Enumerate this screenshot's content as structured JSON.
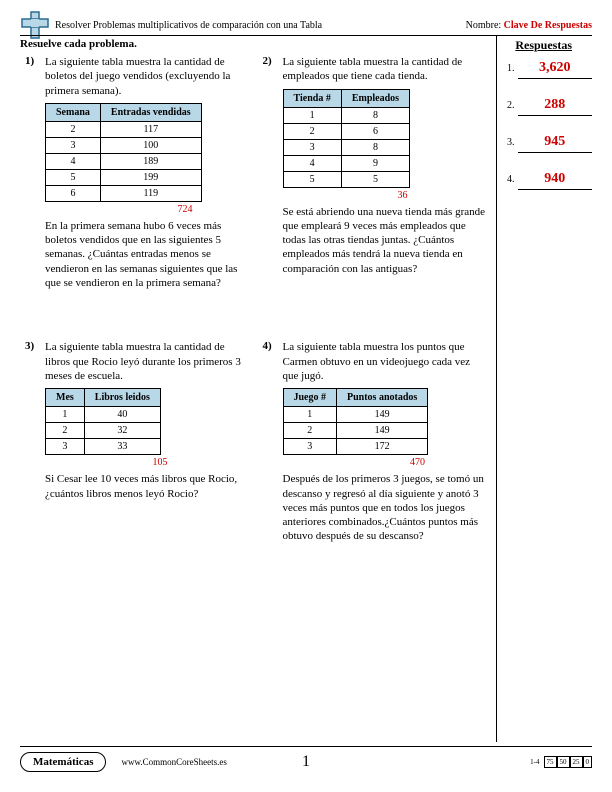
{
  "header": {
    "title": "Resolver Problemas multiplicativos de comparación con una Tabla",
    "name_label": "Nombre:",
    "answer_key": "Clave De Respuestas"
  },
  "instruction": "Resuelve cada problema.",
  "answers_header": "Respuestas",
  "answers": [
    {
      "num": "1.",
      "value": "3,620"
    },
    {
      "num": "2.",
      "value": "288"
    },
    {
      "num": "3.",
      "value": "945"
    },
    {
      "num": "4.",
      "value": "940"
    }
  ],
  "problems": [
    {
      "num": "1)",
      "intro": "La siguiente tabla muestra la cantidad de boletos del juego vendidos (excluyendo la primera semana).",
      "headers": [
        "Semana",
        "Entradas vendidas"
      ],
      "rows": [
        [
          "2",
          "117"
        ],
        [
          "3",
          "100"
        ],
        [
          "4",
          "189"
        ],
        [
          "5",
          "199"
        ],
        [
          "6",
          "119"
        ]
      ],
      "sum": "724",
      "sum_offset": "120px",
      "question": "En la primera semana hubo 6 veces más boletos vendidos que en las siguientes 5 semanas. ¿Cuántas entradas menos se vendieron en las semanas siguientes que las que se vendieron en la primera semana?"
    },
    {
      "num": "2)",
      "intro": "La siguiente tabla muestra la cantidad de empleados que tiene cada tienda.",
      "headers": [
        "Tienda #",
        "Empleados"
      ],
      "rows": [
        [
          "1",
          "8"
        ],
        [
          "2",
          "6"
        ],
        [
          "3",
          "8"
        ],
        [
          "4",
          "9"
        ],
        [
          "5",
          "5"
        ]
      ],
      "sum": "36",
      "sum_offset": "100px",
      "question": "Se está abriendo una nueva tienda más grande que empleará 9 veces más empleados que todas las otras tiendas juntas. ¿Cuántos empleados más tendrá la nueva tienda en comparación con las antiguas?"
    },
    {
      "num": "3)",
      "intro": "La siguiente tabla muestra la cantidad de libros que Rocio leyó durante los primeros 3 meses de escuela.",
      "headers": [
        "Mes",
        "Libros leidos"
      ],
      "rows": [
        [
          "1",
          "40"
        ],
        [
          "2",
          "32"
        ],
        [
          "3",
          "33"
        ]
      ],
      "sum": "105",
      "sum_offset": "95px",
      "question": "Si Cesar lee 10 veces más libros que Rocio, ¿cuántos libros menos leyó Rocio?"
    },
    {
      "num": "4)",
      "intro": "La siguiente tabla muestra los puntos que Carmen obtuvo en un videojuego cada vez que jugó.",
      "headers": [
        "Juego #",
        "Puntos anotados"
      ],
      "rows": [
        [
          "1",
          "149"
        ],
        [
          "2",
          "149"
        ],
        [
          "3",
          "172"
        ]
      ],
      "sum": "470",
      "sum_offset": "115px",
      "question": "Después de los primeros 3 juegos, se tomó un descanso y regresó al día siguiente y anotó 3 veces más puntos que en todos los juegos anteriores combinados.¿Cuántos puntos más obtuvo después de su descanso?"
    }
  ],
  "footer": {
    "subject": "Matemáticas",
    "website": "www.CommonCoreSheets.es",
    "page": "1",
    "grade_range": "1-4",
    "grade_boxes": [
      "75",
      "50",
      "25",
      "0"
    ]
  }
}
